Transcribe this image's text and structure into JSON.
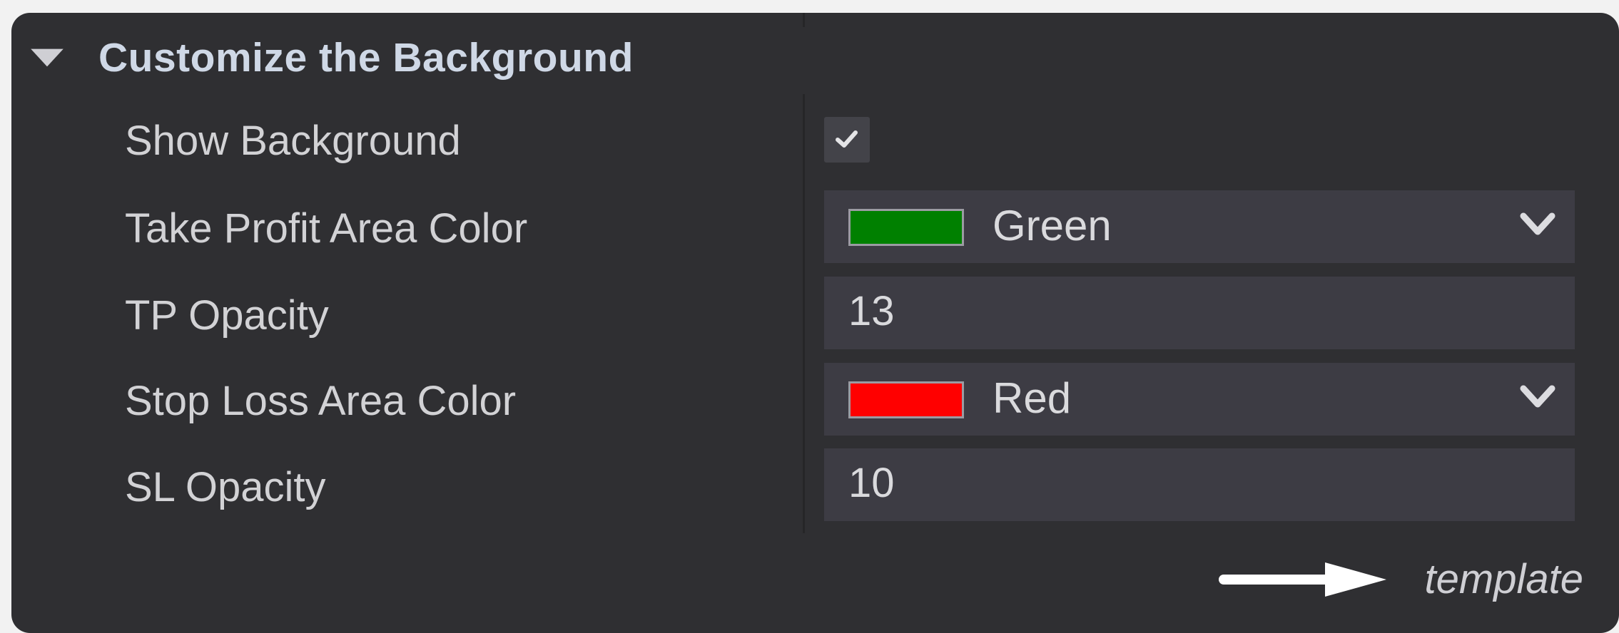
{
  "section": {
    "title": "Customize the Background"
  },
  "settings": {
    "show_background": {
      "label": "Show Background",
      "checked": true
    },
    "tp_color": {
      "label": "Take Profit Area Color",
      "value": "Green",
      "swatch": "#008000"
    },
    "tp_opacity": {
      "label": "TP Opacity",
      "value": "13"
    },
    "sl_color": {
      "label": "Stop Loss Area Color",
      "value": "Red",
      "swatch": "#ff0000"
    },
    "sl_opacity": {
      "label": "SL Opacity",
      "value": "10"
    }
  },
  "footer": {
    "text": "template"
  }
}
